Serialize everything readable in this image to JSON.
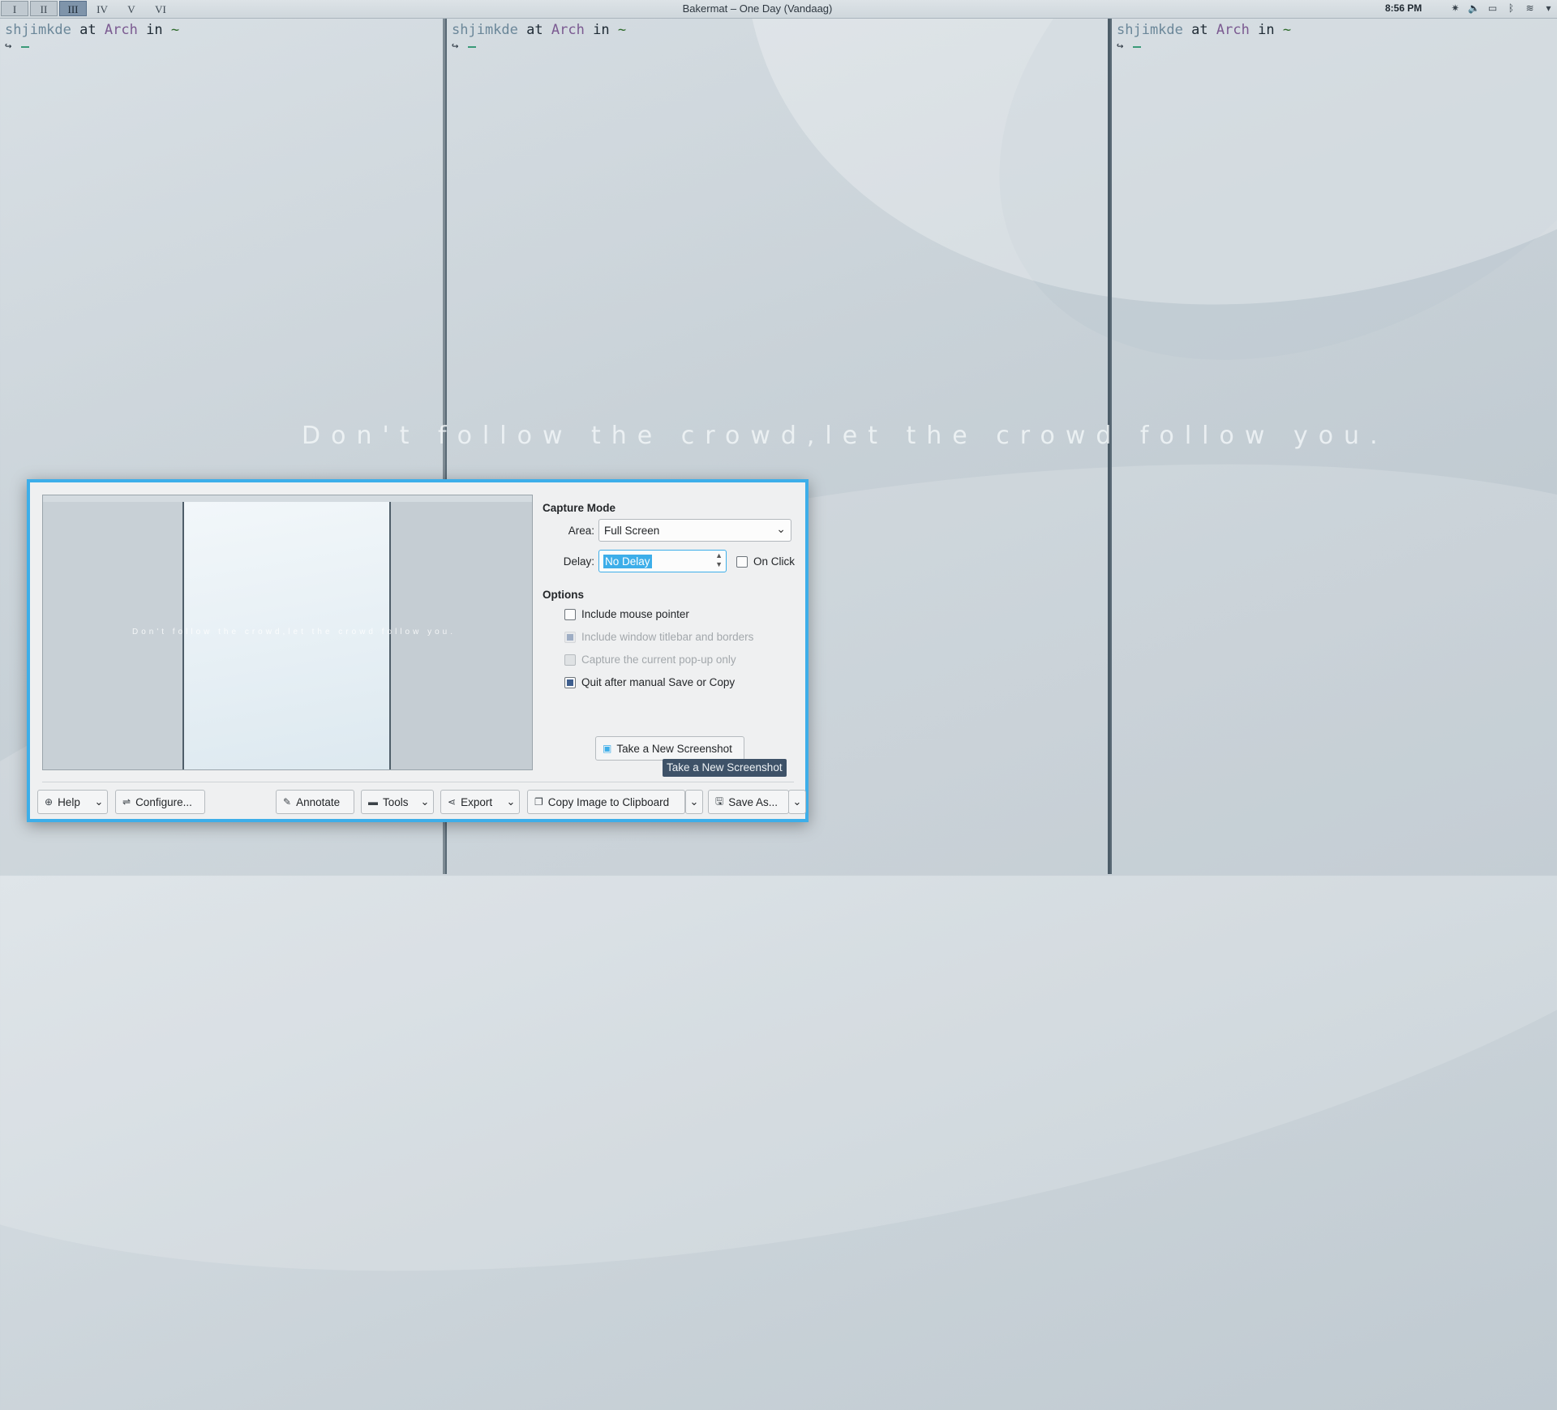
{
  "topbar": {
    "desktops": [
      "I",
      "II",
      "III",
      "IV",
      "V",
      "VI"
    ],
    "current_desktop": "III",
    "window_title": "Bakermat – One Day (Vandaag)",
    "clock": "8:56 PM",
    "tray_icons": [
      "network-icon",
      "volume-icon",
      "battery-icon",
      "bluetooth-icon",
      "wifi-icon",
      "expand-icon"
    ]
  },
  "terminals": [
    {
      "user": "shjimkde",
      "at": "at",
      "host": "Arch",
      "in": "in",
      "dir": "~",
      "line2": "↪"
    },
    {
      "user": "shjimkde",
      "at": "at",
      "host": "Arch",
      "in": "in",
      "dir": "~",
      "line2": "↪"
    },
    {
      "user": "shjimkde",
      "at": "at",
      "host": "Arch",
      "in": "in",
      "dir": "~",
      "line2": "↪"
    }
  ],
  "wallpaper_quote": "Don't follow the crowd,let the crowd follow you.",
  "dialog": {
    "capture_mode_title": "Capture Mode",
    "area_label": "Area:",
    "area_value": "Full Screen",
    "delay_label": "Delay:",
    "delay_value": "No Delay",
    "on_click_label": "On Click",
    "options_title": "Options",
    "options": {
      "mouse_pointer": "Include mouse pointer",
      "titlebar": "Include window titlebar and borders",
      "popup": "Capture the current pop-up only",
      "quit_after": "Quit after manual Save or Copy"
    },
    "take_screenshot": "Take a New Screenshot",
    "tooltip": "Take a New Screenshot",
    "buttons": {
      "help": "Help",
      "configure": "Configure...",
      "annotate": "Annotate",
      "tools": "Tools",
      "export": "Export",
      "copy": "Copy Image to Clipboard",
      "save_as": "Save As..."
    }
  }
}
